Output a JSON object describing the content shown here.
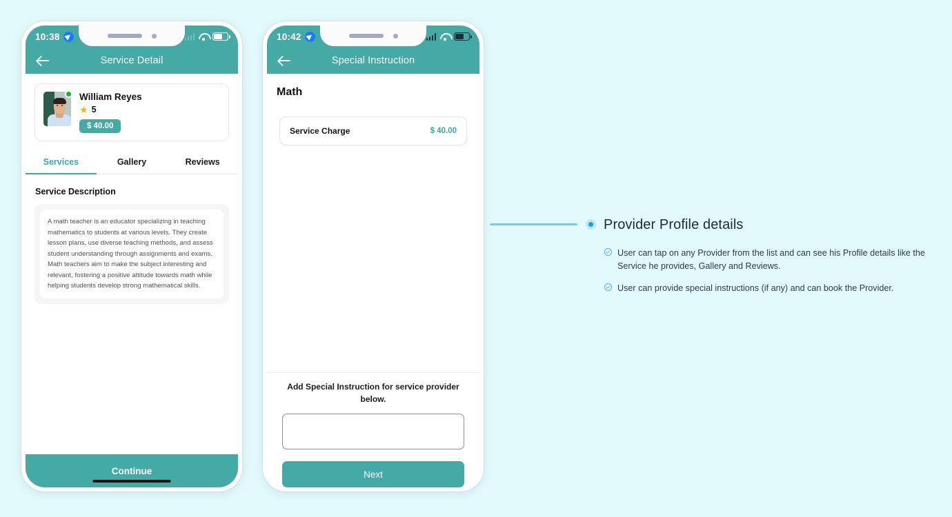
{
  "background_color": "#e3fafd",
  "accent_teal": "#45a9a6",
  "accent_blue": "#1e9fd4",
  "phone1": {
    "status": {
      "time": "10:38",
      "location_icon": "location-arrow-icon"
    },
    "appbar": {
      "back_icon": "back-arrow-icon",
      "title": "Service Detail"
    },
    "provider": {
      "name": "William Reyes",
      "rating": "5",
      "star_icon": "star-icon",
      "price": "$ 40.00",
      "online_status": "online"
    },
    "tabs": [
      {
        "label": "Services",
        "active": true
      },
      {
        "label": "Gallery",
        "active": false
      },
      {
        "label": "Reviews",
        "active": false
      }
    ],
    "section_title": "Service Description",
    "description": "A math teacher is an educator specializing in teaching mathematics to students at various levels. They create lesson plans, use diverse teaching methods, and assess student understanding through assignments and exams. Math teachers aim to make the subject interesting and relevant, fostering a positive attitude towards math while helping students develop strong mathematical skills.",
    "continue_label": "Continue"
  },
  "phone2": {
    "status": {
      "time": "10:42",
      "location_icon": "location-arrow-icon"
    },
    "appbar": {
      "back_icon": "back-arrow-icon",
      "title": "Special Instruction"
    },
    "service_title": "Math",
    "charge": {
      "label": "Service Charge",
      "value": "$ 40.00"
    },
    "footer": {
      "prompt": "Add Special Instruction for service provider below.",
      "input_value": "",
      "input_placeholder": "",
      "next_label": "Next"
    }
  },
  "annotation": {
    "title": "Provider Profile details",
    "items": [
      {
        "check_icon": "circle-check-icon",
        "text": "User can tap on any Provider from the list and can see his Profile details like the Service he provides, Gallery and Reviews."
      },
      {
        "check_icon": "circle-check-icon",
        "text": "User can provide special instructions (if any) and can book the Provider."
      }
    ]
  }
}
